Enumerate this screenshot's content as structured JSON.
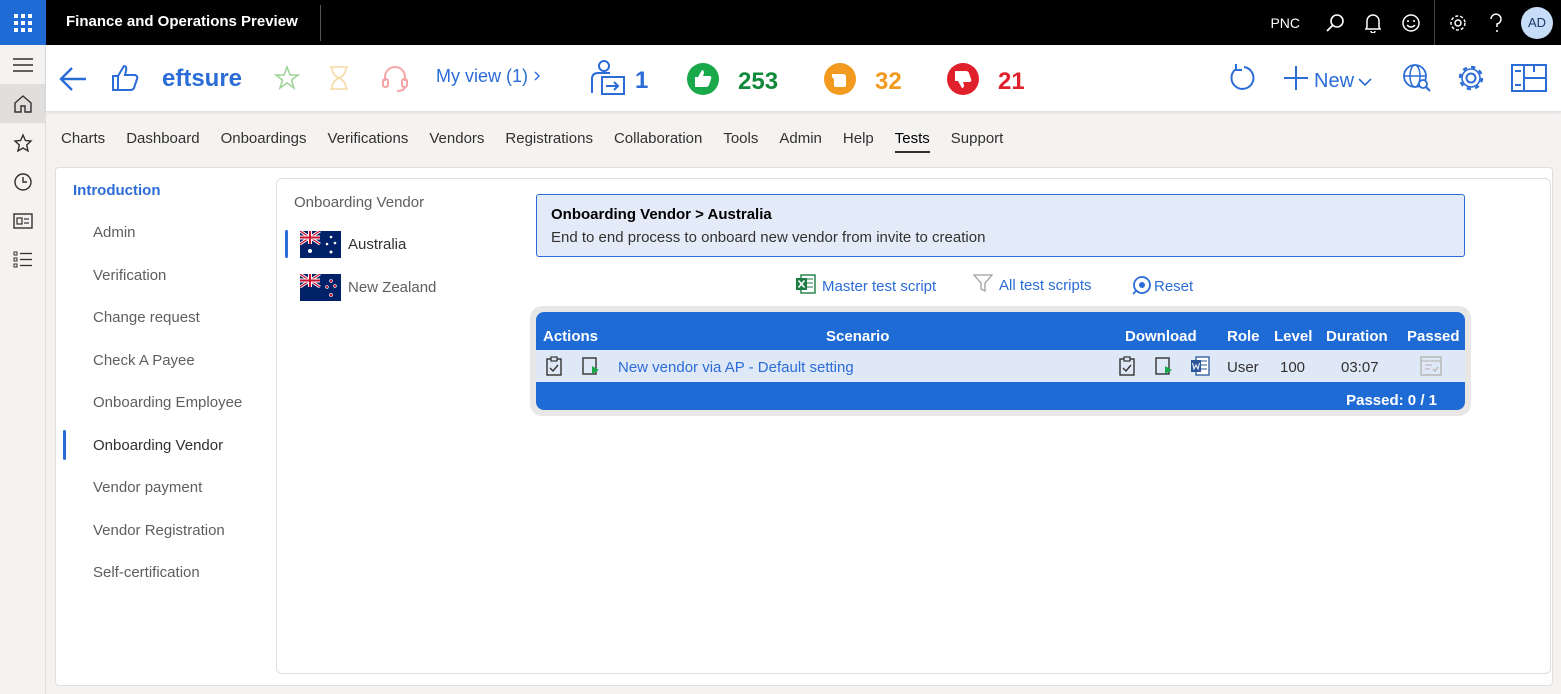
{
  "header": {
    "app_title": "Finance and Operations Preview",
    "company": "PNC",
    "avatar_initials": "AD"
  },
  "action_pane": {
    "brand": "eftsure",
    "my_view": "My view (1)",
    "counts": {
      "users": "1",
      "passed": "253",
      "warning": "32",
      "failed": "21"
    },
    "new_label": "New"
  },
  "tabs": [
    "Charts",
    "Dashboard",
    "Onboardings",
    "Verifications",
    "Vendors",
    "Registrations",
    "Collaboration",
    "Tools",
    "Admin",
    "Help",
    "Tests",
    "Support"
  ],
  "active_tab": "Tests",
  "nav": {
    "heading": "Introduction",
    "items": [
      "Admin",
      "Verification",
      "Change request",
      "Check A Payee",
      "Onboarding Employee",
      "Onboarding Vendor",
      "Vendor payment",
      "Vendor Registration",
      "Self-certification"
    ],
    "active": "Onboarding Vendor"
  },
  "subnav": {
    "heading": "Onboarding Vendor",
    "countries": [
      "Australia",
      "New Zealand"
    ],
    "active": "Australia"
  },
  "info": {
    "title": "Onboarding Vendor > Australia",
    "description": "End to end process to onboard new vendor from invite to creation"
  },
  "links": {
    "master": "Master test script",
    "all": "All test scripts",
    "reset": "Reset"
  },
  "table": {
    "headers": {
      "actions": "Actions",
      "scenario": "Scenario",
      "download": "Download",
      "role": "Role",
      "level": "Level",
      "duration": "Duration",
      "passed": "Passed"
    },
    "rows": [
      {
        "scenario": "New vendor via AP - Default setting",
        "role": "User",
        "level": "100",
        "duration": "03:07"
      }
    ],
    "footer": "Passed: 0 / 1"
  },
  "colors": {
    "accent": "#2b6cd6",
    "table_header": "#1f6bd6",
    "green": "#19a84a",
    "orange": "#f29a1f",
    "red": "#e0202a"
  }
}
